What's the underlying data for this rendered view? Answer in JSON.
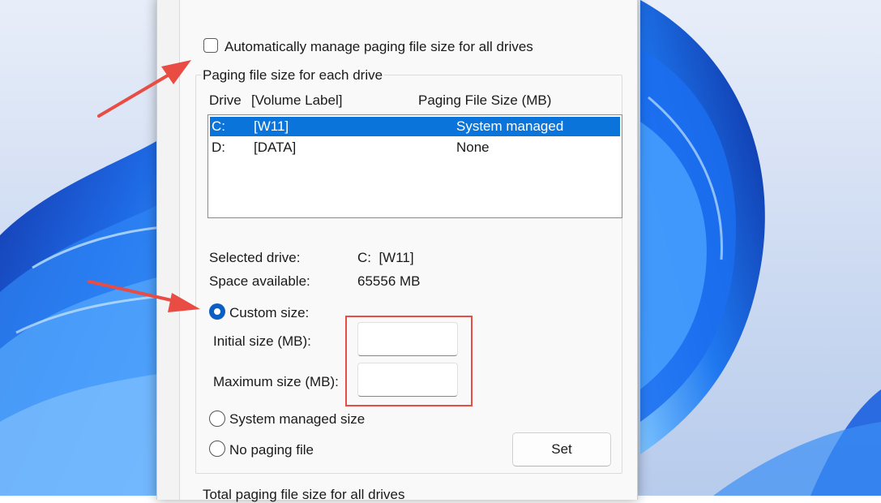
{
  "dialog": {
    "auto_manage_label": "Automatically manage paging file size for all drives",
    "auto_manage_checked": false,
    "group_title": "Paging file size for each drive",
    "columns": {
      "drive": "Drive",
      "volume_label": "[Volume Label]",
      "paging_size": "Paging File Size (MB)"
    },
    "drives": [
      {
        "drive": "C:",
        "label": "[W11]",
        "size": "System managed",
        "selected": true
      },
      {
        "drive": "D:",
        "label": "[DATA]",
        "size": "None",
        "selected": false
      }
    ],
    "selected_drive_label": "Selected drive:",
    "selected_drive_value": "C:  [W11]",
    "space_available_label": "Space available:",
    "space_available_value": "65556 MB",
    "custom_size_label": "Custom size:",
    "initial_size_label": "Initial size (MB):",
    "initial_size_value": "",
    "maximum_size_label": "Maximum size (MB):",
    "maximum_size_value": "",
    "system_managed_label": "System managed size",
    "no_paging_label": "No paging file",
    "selected_option": "custom",
    "set_button_label": "Set",
    "total_section_label": "Total paging file size for all drives"
  },
  "colors": {
    "selection": "#0a74da",
    "radio_checked": "#0a5fc4",
    "annotation": "#e84c43"
  }
}
